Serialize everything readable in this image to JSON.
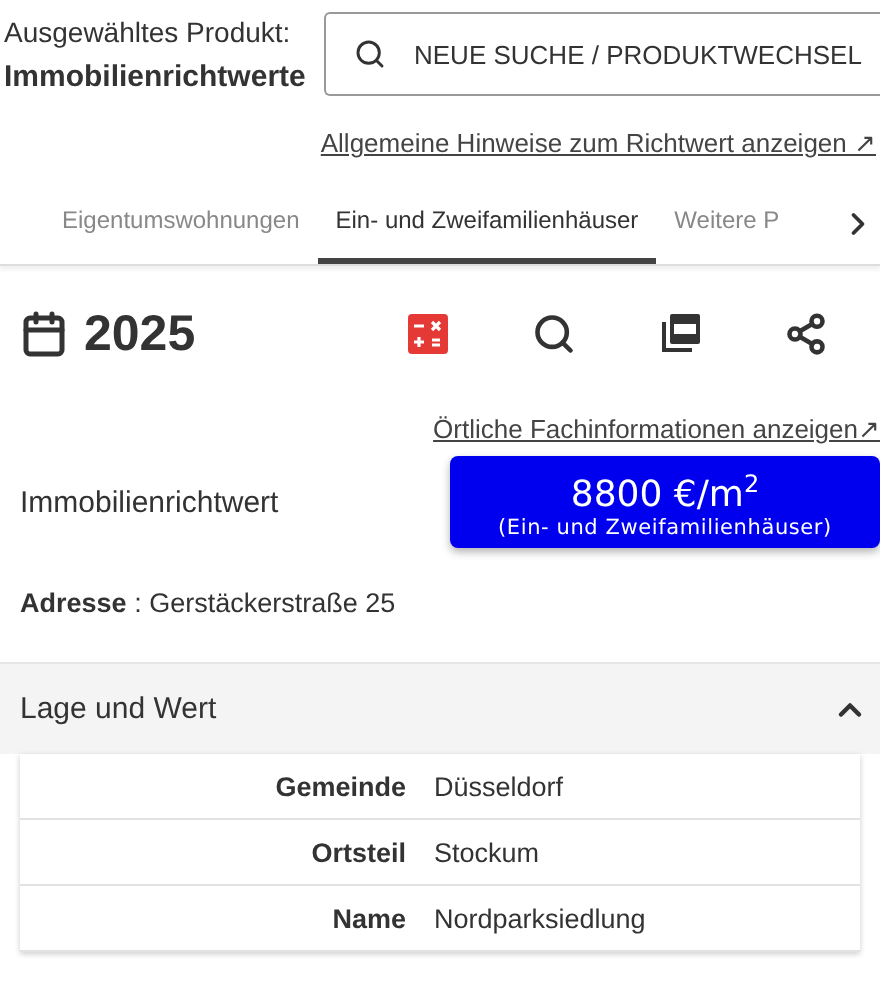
{
  "header": {
    "label": "Ausgewähltes Produkt:",
    "product": "Immobilienrichtwerte",
    "search_button": "NEUE SUCHE / PRODUKTWECHSEL"
  },
  "general_link": "Allgemeine Hinweise zum Richtwert anzeigen ↗",
  "tabs": [
    {
      "label": "Eigentumswohnungen",
      "selected": false
    },
    {
      "label": "Ein- und Zweifamilienhäuser",
      "selected": true
    },
    {
      "label": "Weitere P",
      "selected": false
    }
  ],
  "year": "2025",
  "local_link": "Örtliche Fachinformationen anzeigen↗",
  "value": {
    "label": "Immobilienrichtwert",
    "amount": "8800 €/m$^{2}$",
    "subtitle": "(Ein- und Zweifamilienhäuser)"
  },
  "address": {
    "label": "Adresse",
    "separator": ":",
    "value": "Gerstäckerstraße 25"
  },
  "section": {
    "title": "Lage und Wert",
    "expanded": true,
    "rows": [
      {
        "key": "Gemeinde",
        "value": "Düsseldorf"
      },
      {
        "key": "Ortsteil",
        "value": "Stockum"
      },
      {
        "key": "Name",
        "value": "Nordparksiedlung"
      }
    ]
  }
}
